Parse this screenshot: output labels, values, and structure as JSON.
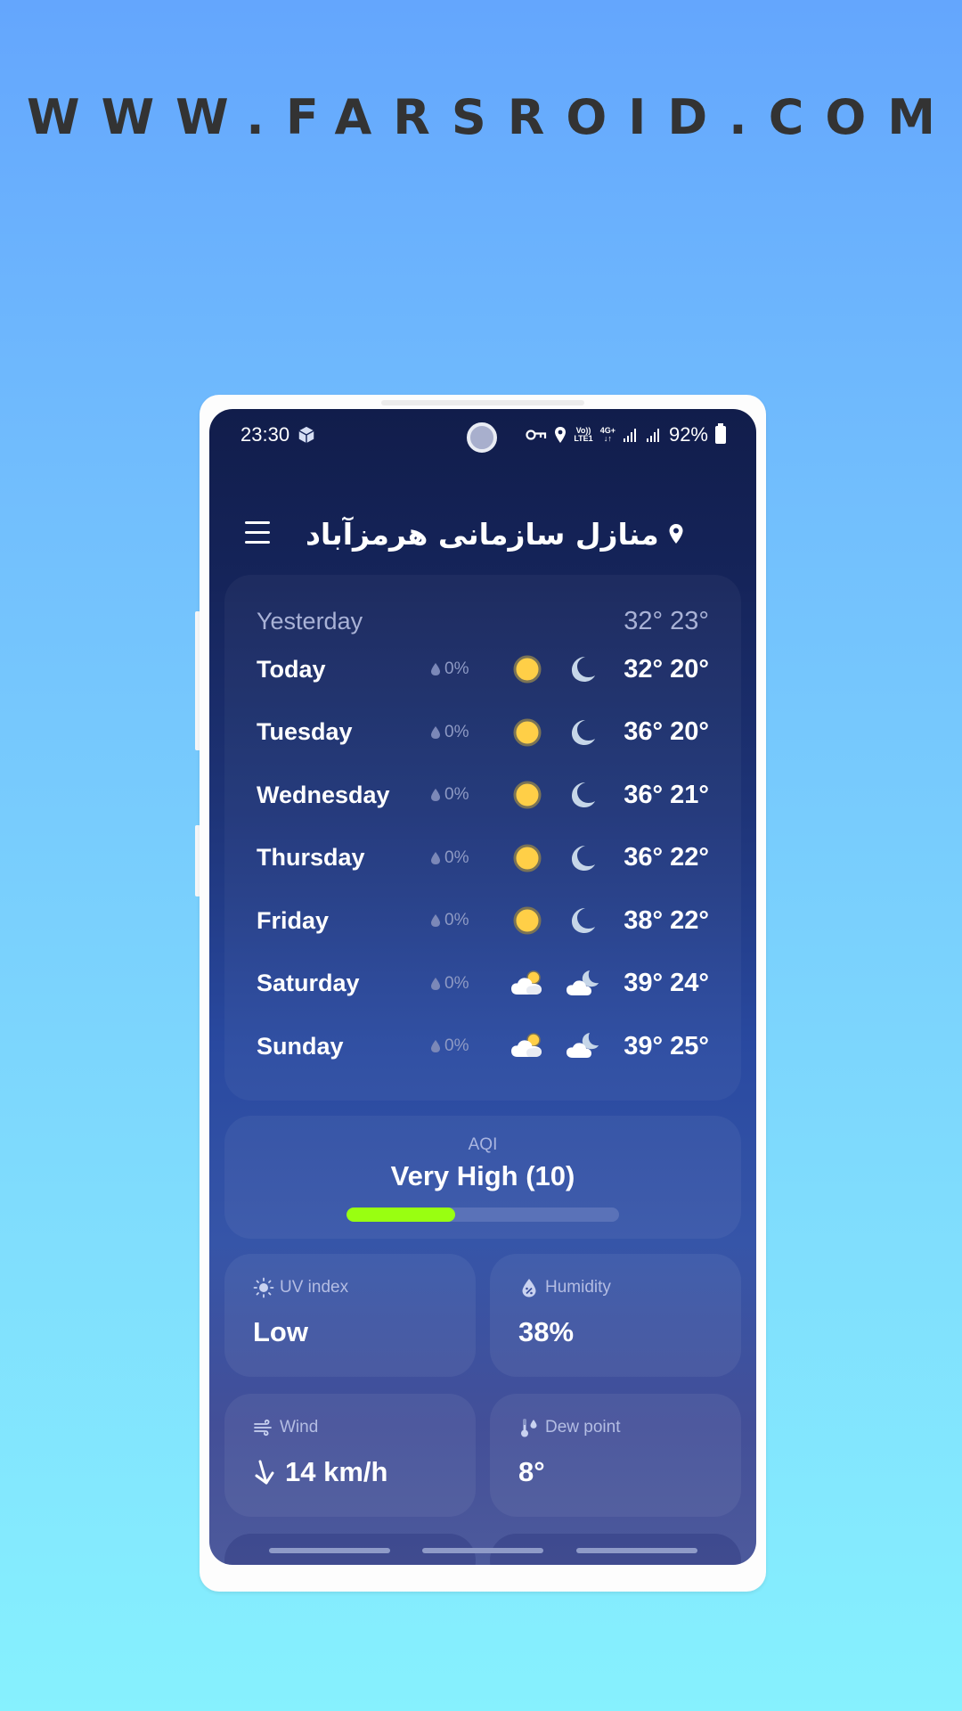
{
  "watermark": "WWW.FARSROID.COM",
  "status_bar": {
    "time": "23:30",
    "notification_icon": "package-icon",
    "volte_top": "Vo))",
    "volte_bottom": "LTE1",
    "network_top": "4G+",
    "network_bottom": "↓↑",
    "battery": "92%"
  },
  "header": {
    "location": "منازل سازمانی هرمزآباد"
  },
  "forecast": {
    "yesterday": {
      "day": "Yesterday",
      "temps": "32° 23°"
    },
    "days": [
      {
        "day": "Today",
        "precip": "0%",
        "day_icon": "sun",
        "night_icon": "moon",
        "temps": "32° 20°"
      },
      {
        "day": "Tuesday",
        "precip": "0%",
        "day_icon": "sun",
        "night_icon": "moon",
        "temps": "36° 20°"
      },
      {
        "day": "Wednesday",
        "precip": "0%",
        "day_icon": "sun",
        "night_icon": "moon",
        "temps": "36° 21°"
      },
      {
        "day": "Thursday",
        "precip": "0%",
        "day_icon": "sun",
        "night_icon": "moon",
        "temps": "36° 22°"
      },
      {
        "day": "Friday",
        "precip": "0%",
        "day_icon": "sun",
        "night_icon": "moon",
        "temps": "38° 22°"
      },
      {
        "day": "Saturday",
        "precip": "0%",
        "day_icon": "partly-cloudy-day",
        "night_icon": "partly-cloudy-night",
        "temps": "39° 24°"
      },
      {
        "day": "Sunday",
        "precip": "0%",
        "day_icon": "partly-cloudy-day",
        "night_icon": "partly-cloudy-night",
        "temps": "39° 25°"
      }
    ]
  },
  "aqi": {
    "label": "AQI",
    "value": "Very High (10)",
    "bar_fraction": 0.4,
    "bar_color": "#99ff11"
  },
  "tiles": {
    "uv": {
      "label": "UV index",
      "value": "Low"
    },
    "humidity": {
      "label": "Humidity",
      "value": "38%"
    },
    "wind": {
      "label": "Wind",
      "value": "14 km/h",
      "direction": "south-southwest"
    },
    "dew_point": {
      "label": "Dew point",
      "value": "8°"
    }
  }
}
